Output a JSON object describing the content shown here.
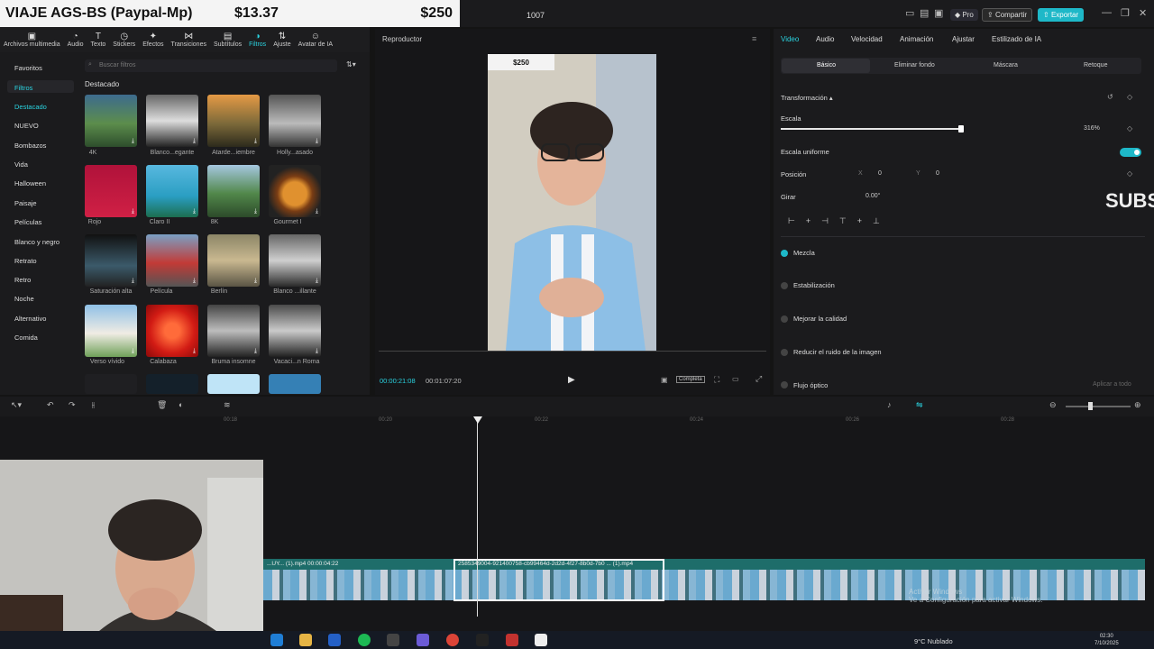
{
  "banner": {
    "text": "VIAJE AGS-BS (Paypal-Mp)",
    "price1": "$13.37",
    "price2": "$250"
  },
  "window": {
    "title": "1007",
    "pro_label": "Pro",
    "share_label": "Compartir",
    "export_label": "Exportar",
    "accent": "#1eb8c8"
  },
  "toolbar": {
    "items": [
      {
        "label": "Archivos multimedia",
        "icon": "media-icon"
      },
      {
        "label": "Audio",
        "icon": "audio-icon"
      },
      {
        "label": "Texto",
        "icon": "text-icon"
      },
      {
        "label": "Stickers",
        "icon": "sticker-icon"
      },
      {
        "label": "Efectos",
        "icon": "effects-icon"
      },
      {
        "label": "Transiciones",
        "icon": "transitions-icon"
      },
      {
        "label": "Subtítulos",
        "icon": "subtitles-icon"
      },
      {
        "label": "Filtros",
        "icon": "filters-icon"
      },
      {
        "label": "Ajuste",
        "icon": "adjust-icon"
      },
      {
        "label": "Avatar de IA",
        "icon": "avatar-icon"
      }
    ]
  },
  "filters": {
    "favorites": "Favoritos",
    "group": "Filtros",
    "categories": [
      "Destacado",
      "NUEVO",
      "Bombazos",
      "Vida",
      "Halloween",
      "Paisaje",
      "Películas",
      "Blanco y negro",
      "Retrato",
      "Retro",
      "Noche",
      "Alternativo",
      "Comida"
    ],
    "search_placeholder": "Buscar filtros",
    "section": "Destacado",
    "items": [
      "4K",
      "Blanco...egante",
      "Atarde...iembre",
      "Holly...asado",
      "Rojo",
      "Claro II",
      "8K",
      "Gourmet I",
      "Saturación alta",
      "Película",
      "Berlín",
      "Blanco ...illante",
      "Verso vívido",
      "Calabaza",
      "Bruma insomne",
      "Vacaci...n Roma"
    ]
  },
  "player": {
    "title": "Reproductor",
    "overlay_price": "$250",
    "time_current": "00:00:21:08",
    "time_total": "00:01:07:20",
    "quality": "Completa"
  },
  "inspector": {
    "tabs": [
      "Video",
      "Audio",
      "Velocidad",
      "Animación",
      "Ajustar",
      "Estilizado de IA"
    ],
    "subtabs": [
      "Básico",
      "Eliminar fondo",
      "Máscara",
      "Retoque"
    ],
    "transform": "Transformación",
    "scale_label": "Escala",
    "scale_value": "316%",
    "scale_fraction": 0.65,
    "uniform_label": "Escala uniforme",
    "position_label": "Posición",
    "pos_x_label": "X",
    "pos_x": "0",
    "pos_y_label": "Y",
    "pos_y": "0",
    "rotate_label": "Girar",
    "rotate_value": "0.00°",
    "options": [
      "Mezcla",
      "Estabilización",
      "Mejorar la calidad",
      "Reducir el ruido de la imagen",
      "Flujo óptico"
    ],
    "apply_all": "Aplicar a todo",
    "overlay_text": "SUBS"
  },
  "timeline": {
    "ruler": [
      "00:16",
      "00:18",
      "00:20",
      "00:22",
      "00:24",
      "00:26",
      "00:28"
    ],
    "clip_label": "...UY... (1).mp4  00:00:04:22",
    "clip2_label": "2585349004-921400758-cb99464d-2d2d-4f27-8b0d-7b0 ... (1).mp4"
  },
  "taskbar": {
    "weather": "9°C  Nublado",
    "time": "02:30",
    "date": "7/10/2025"
  },
  "watermark": {
    "line1": "Activar Windows",
    "line2": "Ve a Configuración para activar Windows."
  }
}
